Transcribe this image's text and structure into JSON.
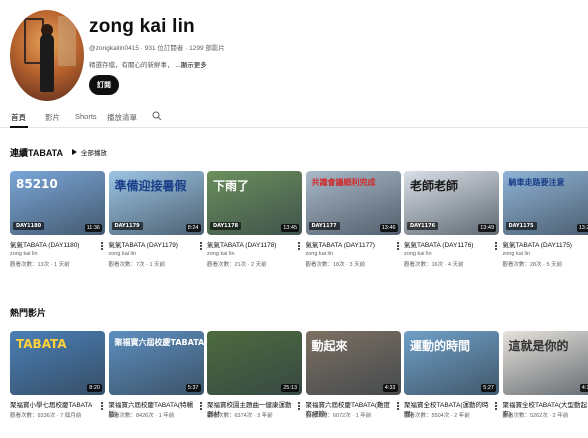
{
  "channel": {
    "name": "zong kai lin",
    "meta": "@zongkailin0415 · 931 位訂閱者 · 1299 部影片",
    "desc": "精選存檔，有關心的新鮮事，",
    "more": "...顯示更多",
    "subscribe": "訂閱"
  },
  "tabs": [
    {
      "label": "首頁"
    },
    {
      "label": "影片"
    },
    {
      "label": "Shorts"
    },
    {
      "label": "播放清單"
    }
  ],
  "sections": [
    {
      "title": "連續TABATA",
      "play_all": "全部播放",
      "videos": [
        {
          "title": "氣氣TABATA (DAY1180)",
          "owner": "zong kai lin",
          "stats": "觀看次數：13次 · 1 天前",
          "duration": "11:36",
          "tag": "DAY1180",
          "caption": "85210",
          "caption_color": "#ffffff",
          "bg": "#7aa6d8"
        },
        {
          "title": "氣氣TABATA (DAY1179)",
          "owner": "zong kai lin",
          "stats": "觀看次數：7次 · 1 天前",
          "duration": "8:24",
          "tag": "DAY1179",
          "caption": "準備迎接暑假",
          "caption_color": "#1a3f8a",
          "bg": "#9cc4e4"
        },
        {
          "title": "氣氣TABATA (DAY1178)",
          "owner": "zong kai lin",
          "stats": "觀看次數：21次 · 2 天前",
          "duration": "13:45",
          "tag": "DAY1178",
          "caption": "下雨了",
          "caption_color": "#ffffff",
          "bg": "#6b8f5c"
        },
        {
          "title": "氣氣TABATA (DAY1177)",
          "owner": "zong kai lin",
          "stats": "觀看次數：18次 · 3 天前",
          "duration": "13:46",
          "tag": "DAY1177",
          "caption": "共識會議順利完成",
          "caption_color": "#d22a2a",
          "bg": "#a9b9c9"
        },
        {
          "title": "氣氣TABATA (DAY1176)",
          "owner": "zong kai lin",
          "stats": "觀看次數：16次 · 4 天前",
          "duration": "13:49",
          "tag": "DAY1176",
          "caption": "老師老師",
          "caption_color": "#1a1a1a",
          "bg": "#d9dfe6"
        },
        {
          "title": "氣氣TABATA (DAY1175)",
          "owner": "zong kai lin",
          "stats": "觀看次數：28次 · 5 天前",
          "duration": "13:25",
          "tag": "DAY1175",
          "caption": "騎車走路要注意",
          "caption_color": "#1a3f8a",
          "bg": "#8fb3d6"
        }
      ]
    },
    {
      "title": "熱門影片",
      "videos": [
        {
          "title": "聚福寶小學七屆校慶TABATA",
          "owner": "",
          "stats": "觀看次數：9336次 · 7 個月前",
          "duration": "8:20",
          "tag": "",
          "caption": "TABATA",
          "caption_color": "#ffd23a",
          "bg": "#4a7fb7"
        },
        {
          "title": "聚福寶六屆校慶TABATA(特輯版)",
          "owner": "",
          "stats": "觀看次數：8426次 · 1 年前",
          "duration": "5:37",
          "tag": "",
          "caption": "聚福寶六屆校慶TABATA",
          "caption_color": "#ffffff",
          "bg": "#5d8fc0"
        },
        {
          "title": "聚福寶校園主題曲一健康運動器材",
          "owner": "",
          "stats": "觀看次數：6374次 · 3 年前",
          "duration": "25:13",
          "tag": "",
          "caption": "",
          "caption_color": "#ffffff",
          "bg": "#4d6b3e"
        },
        {
          "title": "聚福寶六屆校慶TABATA(難度有細節)",
          "owner": "",
          "stats": "觀看次數：6072次 · 1 年前",
          "duration": "4:33",
          "tag": "",
          "caption": "動起來",
          "caption_color": "#ffffff",
          "bg": "#7d7062"
        },
        {
          "title": "聚福寶全校TABATA(運動的時間)",
          "owner": "",
          "stats": "觀看次數：5504次 · 2 年前",
          "duration": "5:27",
          "tag": "",
          "caption": "運動的時間",
          "caption_color": "#ffffff",
          "bg": "#6fa0c8"
        },
        {
          "title": "聚福寶全校TABATA(大型動起來)",
          "owner": "",
          "stats": "觀看次數：5262次 · 2 年前",
          "duration": "4:19",
          "tag": "",
          "caption": "這就是你的",
          "caption_color": "#333333",
          "bg": "#e7e2dc"
        }
      ]
    }
  ]
}
